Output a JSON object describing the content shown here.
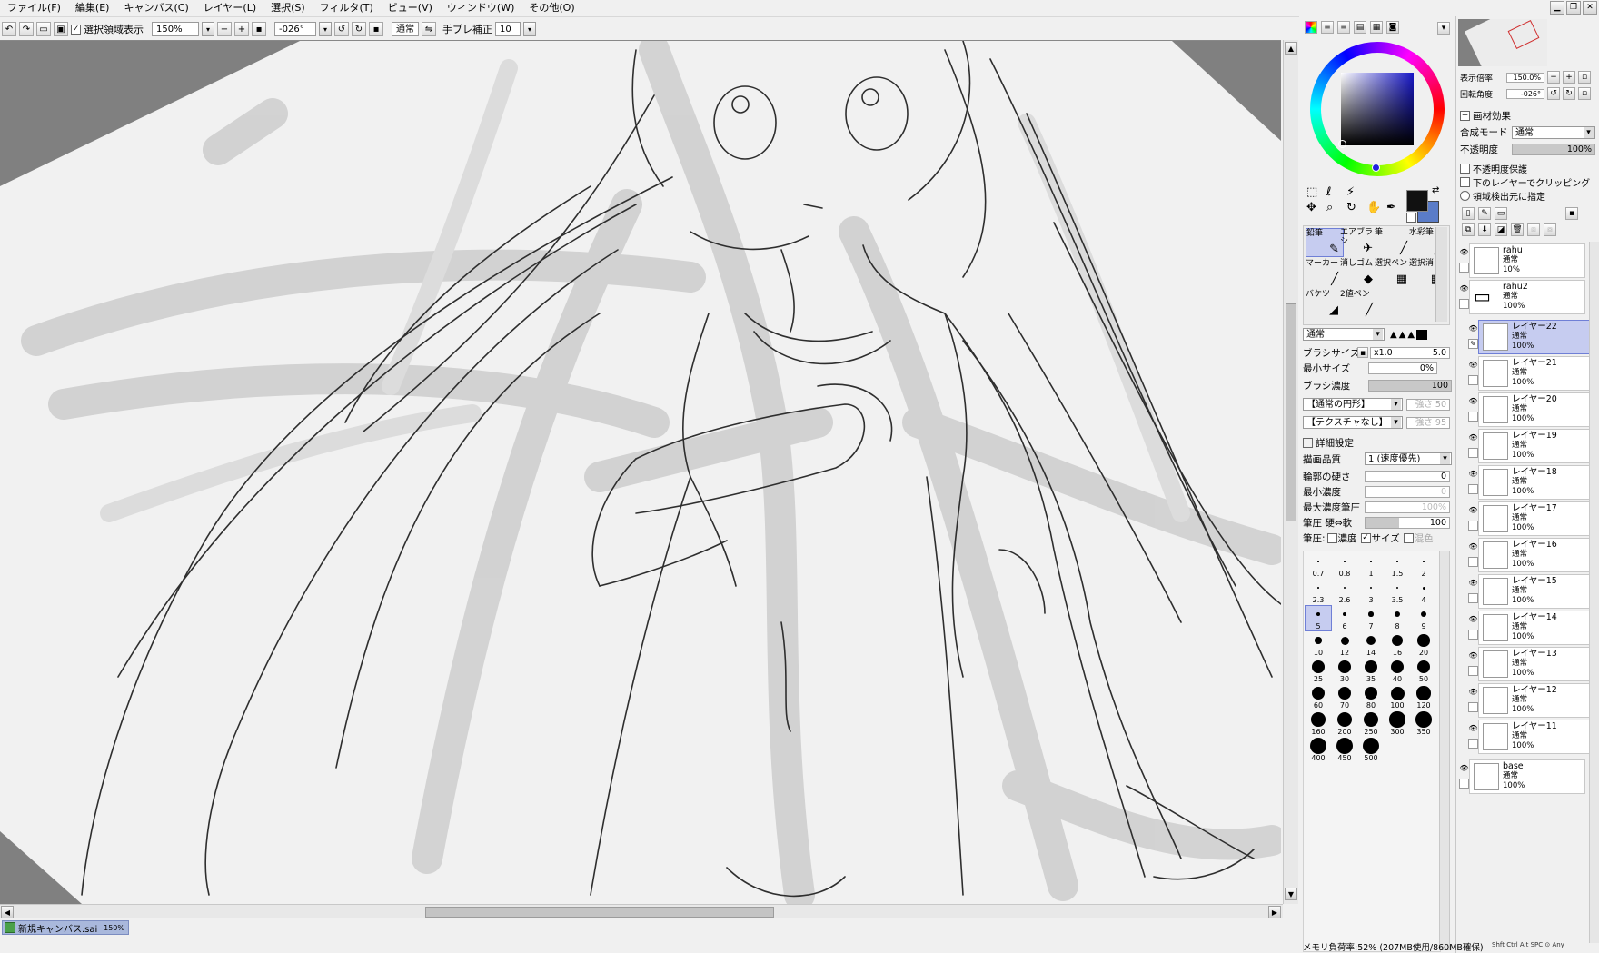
{
  "menu": [
    "ファイル(F)",
    "編集(E)",
    "キャンバス(C)",
    "レイヤー(L)",
    "選択(S)",
    "フィルタ(T)",
    "ビュー(V)",
    "ウィンドウ(W)",
    "その他(O)"
  ],
  "toolbar": {
    "show_selection_label": "選択領域表示",
    "show_selection_checked": true,
    "zoom": "150%",
    "angle": "-026°",
    "mode": "通常",
    "stabilizer_label": "手ブレ補正",
    "stabilizer_value": "10"
  },
  "canvas_tab": {
    "name": "新規キャンバス.sai",
    "zoom": "150%"
  },
  "navigator": {
    "zoom_label": "表示倍率",
    "zoom_value": "150.0%",
    "rotate_label": "回転角度",
    "rotate_value": "-026°"
  },
  "layer_props": {
    "effect_label": "画材効果",
    "blend_label": "合成モード",
    "blend_value": "通常",
    "opacity_label": "不透明度",
    "opacity_value": "100%",
    "opacity_fraction": 1.0,
    "checks": [
      "不透明度保護",
      "下のレイヤーでクリッピング",
      "領域検出元に指定"
    ]
  },
  "tools": [
    {
      "label": "鉛筆",
      "icon": "✎"
    },
    {
      "label": "エアブラシ",
      "icon": "✈"
    },
    {
      "label": "筆",
      "icon": "╱"
    },
    {
      "label": "水彩筆",
      "icon": "╱"
    },
    {
      "label": "マーカー",
      "icon": "╱"
    },
    {
      "label": "消しゴム",
      "icon": "◆"
    },
    {
      "label": "選択ペン",
      "icon": "▦"
    },
    {
      "label": "選択消し",
      "icon": "▦"
    },
    {
      "label": "バケツ",
      "icon": "◢"
    },
    {
      "label": "2値ペン",
      "icon": "╱"
    }
  ],
  "brush": {
    "blend_mode": "通常",
    "size_label": "ブラシサイズ",
    "size_mult": "x1.0",
    "size_value": "5.0",
    "min_size_label": "最小サイズ",
    "min_size_value": "0%",
    "density_label": "ブラシ濃度",
    "density_value": "100",
    "shape_dd": "【通常の円形】",
    "shape_val": "強さ 50",
    "texture_dd": "【テクスチャなし】",
    "texture_val": "強さ 95",
    "detail_label": "詳細設定",
    "quality_label": "描画品質",
    "quality_value": "1 (速度優先)",
    "edge_label": "輪郭の硬さ",
    "edge_value": "0",
    "min_density_label": "最小濃度",
    "min_density_value": "0",
    "max_pressure_label": "最大濃度筆圧",
    "max_pressure_value": "100%",
    "pressure_label": "筆圧 硬⇔軟",
    "pressure_value": "100",
    "pressure_opts_label": "筆圧:",
    "pressure_opts": [
      {
        "label": "濃度",
        "checked": false
      },
      {
        "label": "サイズ",
        "checked": true
      },
      {
        "label": "混色",
        "checked": false
      }
    ],
    "sizes": [
      "0.7",
      "0.8",
      "1",
      "1.5",
      "2",
      "2.3",
      "2.6",
      "3",
      "3.5",
      "4",
      "5",
      "6",
      "7",
      "8",
      "9",
      "10",
      "12",
      "14",
      "16",
      "20",
      "25",
      "30",
      "35",
      "40",
      "50",
      "60",
      "70",
      "80",
      "100",
      "120",
      "160",
      "200",
      "250",
      "300",
      "350",
      "400",
      "450",
      "500"
    ],
    "selected_size": "5"
  },
  "colors": {
    "primary": "#111111",
    "secondary": "#5a7cc8",
    "accent": "#1a1a80"
  },
  "layers": [
    {
      "name": "rahu",
      "mode": "通常",
      "opacity": "10%",
      "type": "layer",
      "selected": false
    },
    {
      "name": "rahu2",
      "mode": "通常",
      "opacity": "100%",
      "type": "folder",
      "selected": false
    },
    {
      "name": "レイヤー22",
      "mode": "通常",
      "opacity": "100%",
      "type": "layer",
      "selected": true
    },
    {
      "name": "レイヤー21",
      "mode": "通常",
      "opacity": "100%",
      "type": "layer",
      "selected": false
    },
    {
      "name": "レイヤー20",
      "mode": "通常",
      "opacity": "100%",
      "type": "layer",
      "selected": false
    },
    {
      "name": "レイヤー19",
      "mode": "通常",
      "opacity": "100%",
      "type": "layer",
      "selected": false
    },
    {
      "name": "レイヤー18",
      "mode": "通常",
      "opacity": "100%",
      "type": "layer",
      "selected": false
    },
    {
      "name": "レイヤー17",
      "mode": "通常",
      "opacity": "100%",
      "type": "layer",
      "selected": false
    },
    {
      "name": "レイヤー16",
      "mode": "通常",
      "opacity": "100%",
      "type": "layer",
      "selected": false
    },
    {
      "name": "レイヤー15",
      "mode": "通常",
      "opacity": "100%",
      "type": "layer",
      "selected": false
    },
    {
      "name": "レイヤー14",
      "mode": "通常",
      "opacity": "100%",
      "type": "layer",
      "selected": false
    },
    {
      "name": "レイヤー13",
      "mode": "通常",
      "opacity": "100%",
      "type": "layer",
      "selected": false
    },
    {
      "name": "レイヤー12",
      "mode": "通常",
      "opacity": "100%",
      "type": "layer",
      "selected": false
    },
    {
      "name": "レイヤー11",
      "mode": "通常",
      "opacity": "100%",
      "type": "layer",
      "selected": false
    },
    {
      "name": "base",
      "mode": "通常",
      "opacity": "100%",
      "type": "layer",
      "selected": false
    }
  ],
  "status": {
    "memory": "メモリ負荷率:52% (207MB使用/860MB確保)",
    "keys": "Shft Ctrl Alt SPC ⊙ Any"
  }
}
